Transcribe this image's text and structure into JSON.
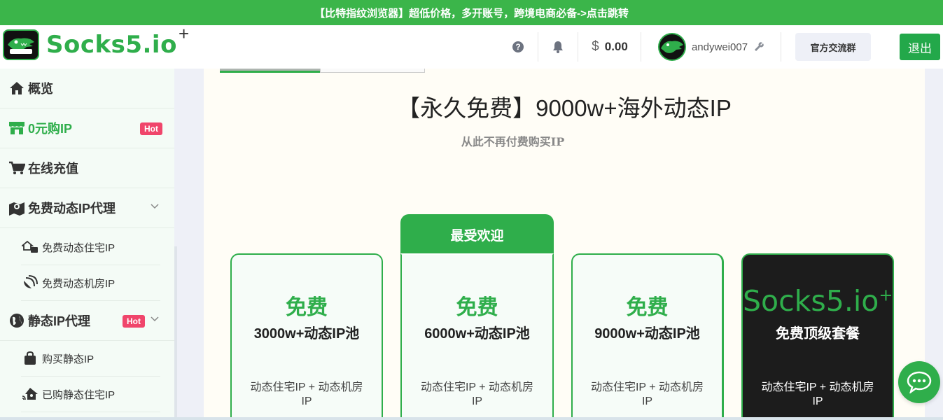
{
  "banner": {
    "text": "【比特指纹浏览器】超低价格，多开账号，跨境电商必备->点击跳转"
  },
  "header": {
    "logo_text": "Socks5.io",
    "logo_plus": "+",
    "logo_badge_text": "Socks5.io",
    "help_icon": "?",
    "currency_symbol": "$",
    "balance": "0.00",
    "username": "andywei007",
    "group_button": "官方交流群",
    "logout_button": "退出"
  },
  "sidebar": {
    "overview": "概览",
    "zero_buy": "0元购IP",
    "zero_buy_badge": "Hot",
    "recharge": "在线充值",
    "free_dynamic": "免费动态IP代理",
    "free_residential": "免费动态住宅IP",
    "free_datacenter": "免费动态机房IP",
    "static_proxy": "静态IP代理",
    "static_badge": "Hot",
    "buy_static": "购买静态IP",
    "bought_static": "已购静态住宅IP"
  },
  "content": {
    "title": "【永久免费】9000w+海外动态IP",
    "subtitle": "从此不再付费购买IP",
    "popular_label": "最受欢迎",
    "cards": [
      {
        "free": "免费",
        "pool": "3000w+动态IP池",
        "desc": "动态住宅IP + 动态机房IP"
      },
      {
        "free": "免费",
        "pool": "6000w+动态IP池",
        "desc": "动态住宅IP + 动态机房IP"
      },
      {
        "free": "免费",
        "pool": "9000w+动态IP池",
        "desc": "动态住宅IP + 动态机房IP"
      },
      {
        "brand": "Socks5.io",
        "brand_plus": "+",
        "pool": "免费顶级套餐",
        "desc": "动态住宅IP + 动态机房IP"
      }
    ]
  },
  "colors": {
    "brand_green": "#2fae4b",
    "banner_green": "#3bb54a",
    "hot_pink": "#f0456b"
  }
}
